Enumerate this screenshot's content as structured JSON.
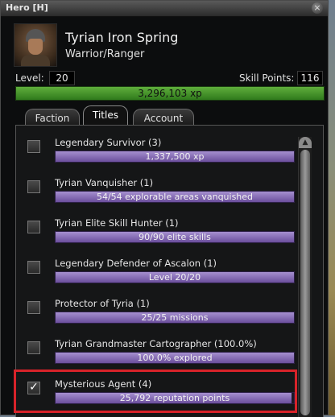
{
  "window": {
    "title": "Hero  [H]",
    "close_glyph": "×"
  },
  "character": {
    "name": "Tyrian Iron Spring",
    "profession": "Warrior/Ranger"
  },
  "level": {
    "label": "Level:",
    "value": "20"
  },
  "skill_points": {
    "label": "Skill Points:",
    "value": "116"
  },
  "xp": {
    "text": "3,296,103 xp",
    "fill_fraction": 1.0
  },
  "tabs": [
    {
      "label": "Faction",
      "active": false
    },
    {
      "label": "Titles",
      "active": true
    },
    {
      "label": "Account",
      "active": false
    }
  ],
  "titles": [
    {
      "name": "Legendary Survivor (3)",
      "progress": "1,337,500 xp",
      "checked": false,
      "fill_fraction": 1.0
    },
    {
      "name": "Tyrian Vanquisher (1)",
      "progress": "54/54 explorable areas vanquished",
      "checked": false,
      "fill_fraction": 1.0
    },
    {
      "name": "Tyrian Elite Skill Hunter (1)",
      "progress": "90/90 elite skills",
      "checked": false,
      "fill_fraction": 1.0
    },
    {
      "name": "Legendary Defender of Ascalon (1)",
      "progress": "Level 20/20",
      "checked": false,
      "fill_fraction": 1.0
    },
    {
      "name": "Protector of Tyria (1)",
      "progress": "25/25 missions",
      "checked": false,
      "fill_fraction": 1.0
    },
    {
      "name": "Tyrian Grandmaster Cartographer (100.0%)",
      "progress": "100.0% explored",
      "checked": false,
      "fill_fraction": 1.0
    },
    {
      "name": "Mysterious Agent (4)",
      "progress": "25,792 reputation points",
      "checked": true,
      "fill_fraction": 0.99
    }
  ],
  "colors": {
    "xp_bar": "#4f9a30",
    "title_bar": "#8a72bd",
    "highlight": "#d8232a"
  }
}
